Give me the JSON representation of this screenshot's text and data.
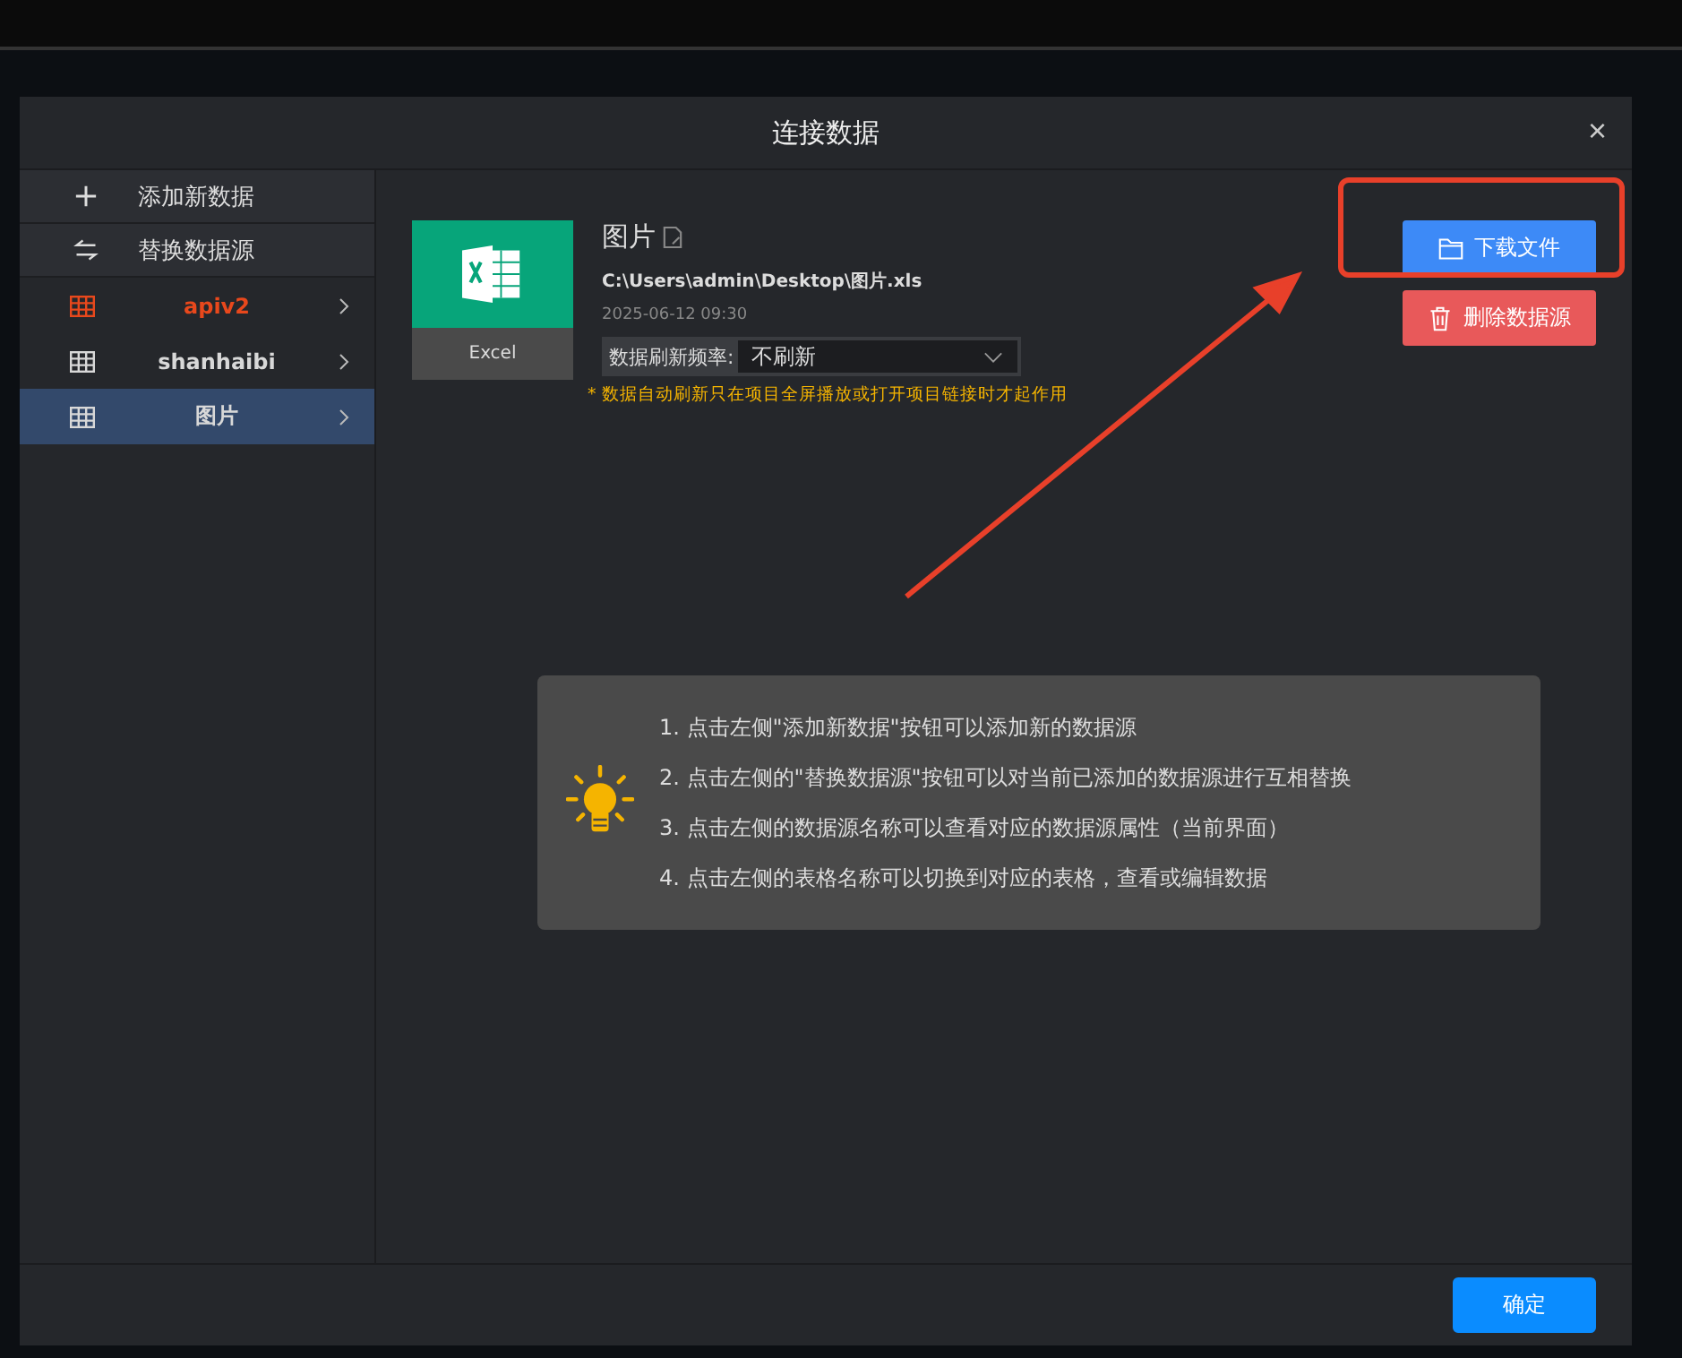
{
  "dialog": {
    "title": "连接数据",
    "close": "×"
  },
  "sidebar": {
    "actions": [
      {
        "kind": "add",
        "label": "添加新数据"
      },
      {
        "kind": "replace",
        "label": "替换数据源"
      }
    ],
    "tables": [
      {
        "name": "apiv2",
        "color": "#e8481c",
        "selected": false
      },
      {
        "name": "shanhaibi",
        "color": "#d8d8d8",
        "selected": false
      },
      {
        "name": "图片",
        "color": "#d8d8d8",
        "selected": true
      }
    ]
  },
  "source": {
    "type_label": "Excel",
    "name": "图片",
    "path": "C:\\Users\\admin\\Desktop\\图片.xls",
    "time": "2025-06-12 09:30",
    "refresh_label": "数据刷新频率:",
    "refresh_value": "不刷新",
    "note": "* 数据自动刷新只在项目全屏播放或打开项目链接时才起作用"
  },
  "buttons": [
    {
      "kind": "download",
      "label": "下载文件"
    },
    {
      "kind": "delete",
      "label": "删除数据源"
    }
  ],
  "tips": [
    "1. 点击左侧\"添加新数据\"按钮可以添加新的数据源",
    "2. 点击左侧的\"替换数据源\"按钮可以对当前已添加的数据源进行互相替换",
    "3. 点击左侧的数据源名称可以查看对应的数据源属性（当前界面）",
    "4. 点击左侧的表格名称可以切换到对应的表格，查看或编辑数据"
  ],
  "footer": {
    "ok": "确定"
  }
}
